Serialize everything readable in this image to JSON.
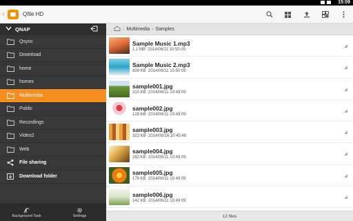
{
  "statusbar": {
    "time": "15:09"
  },
  "app": {
    "title": "Qfile HD"
  },
  "toolbar": {
    "actions": [
      "search-icon",
      "grid-icon",
      "upload-icon",
      "multi-select-icon",
      "overflow-menu-icon"
    ]
  },
  "sidebar": {
    "server": "QNAP",
    "folders": [
      {
        "label": "Qsync",
        "icon": "sync-folder-icon"
      },
      {
        "label": "Download",
        "icon": "folder-icon"
      },
      {
        "label": "home",
        "icon": "folder-icon"
      },
      {
        "label": "homes",
        "icon": "folder-icon"
      },
      {
        "label": "Multimedia",
        "icon": "folder-icon",
        "active": true
      },
      {
        "label": "Public",
        "icon": "folder-icon"
      },
      {
        "label": "Recordings",
        "icon": "folder-icon"
      },
      {
        "label": "Video2",
        "icon": "folder-icon"
      },
      {
        "label": "Web",
        "icon": "folder-icon"
      }
    ],
    "file_sharing": "File sharing",
    "download_folder": "Download folder",
    "bottom": {
      "background_task": "Background Task",
      "settings": "Settings"
    }
  },
  "breadcrumb": {
    "part1": "Multimedia",
    "part2": "Samples"
  },
  "files": [
    {
      "name": "Sample Music 1.mp3",
      "meta": "1.1 MB  2014/06/11 10:50:09",
      "thumb": "music-cover-1"
    },
    {
      "name": "Sample Music 2.mp3",
      "meta": "839 KB  2014/06/11 10:50:09",
      "thumb": "music-cover-2"
    },
    {
      "name": "sample001.jpg",
      "meta": "310 KB  2014/06/11 10:49:09",
      "thumb": "landscape"
    },
    {
      "name": "sample002.jpg",
      "meta": "128 KB  2014/06/11 10:49:09",
      "thumb": "cupcake"
    },
    {
      "name": "sample003.jpg",
      "meta": "322 KB  2014/08/18 10:45:48",
      "thumb": "macarons"
    },
    {
      "name": "sample004.jpg",
      "meta": "282 KB  2014/06/11 10:49:09",
      "thumb": "food"
    },
    {
      "name": "sample005.jpg",
      "meta": "176 KB  2014/06/11 10:49:09",
      "thumb": "orange-flower"
    },
    {
      "name": "sample006.jpg",
      "meta": "142 KB  2014/06/11 10:49:09",
      "thumb": "white-flowers"
    }
  ],
  "footer": {
    "count": "12 files"
  },
  "colors": {
    "accent": "#f68d1f",
    "sidebar_bg": "#383838"
  }
}
